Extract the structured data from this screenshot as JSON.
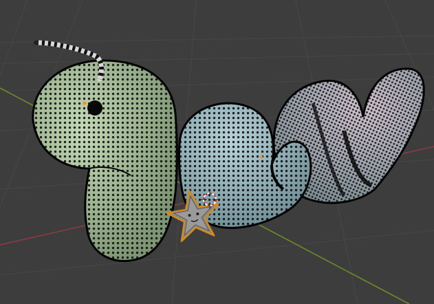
{
  "app": "3D viewport",
  "colors": {
    "background": "#3d3d3d",
    "grid": "#474747",
    "axis_x": "#8c3b43",
    "axis_y": "#6c8b28",
    "head_body": "#a9c29a",
    "mid_body": "#9fbcc4",
    "tail_body": "#b3a7b3",
    "vertex_dots": "#101010",
    "outline": "#000000",
    "star": "#8b8b8b",
    "star_outline": "#d38a1c",
    "origin_dot": "#ff8c1a",
    "cursor_red": "#e02020"
  },
  "objects": [
    {
      "name": "worm-head",
      "icon": "mesh-object"
    },
    {
      "name": "worm-body",
      "icon": "mesh-object"
    },
    {
      "name": "worm-tail",
      "icon": "mesh-object"
    },
    {
      "name": "antenna",
      "icon": "striped-antenna"
    },
    {
      "name": "star-badge",
      "icon": "star-shape"
    }
  ],
  "tools": {
    "cursor": "3d-cursor-icon"
  }
}
